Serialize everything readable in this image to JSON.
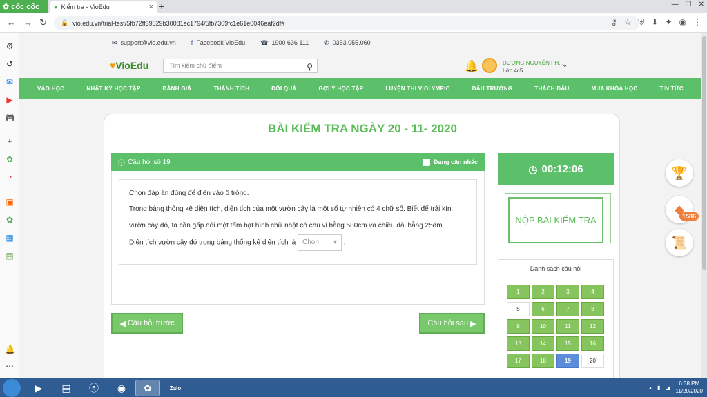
{
  "browser": {
    "brand": "cốc cốc",
    "tab_title": "Kiểm tra - VioEdu",
    "url": "vio.edu.vn/trial-test/5fb72ff39529b30081ec1794/5fb7309fc1e61e0046eaf2df#"
  },
  "header": {
    "email": "support@vio.edu.vn",
    "facebook": "Facebook VioEdu",
    "phone1": "1900 636 111",
    "phone2": "0353.055.060",
    "logo": "VioEdu",
    "search_placeholder": "Tìm kiếm chủ điểm",
    "user_name": "DƯƠNG NGUYỄN PH...",
    "user_class": "Lớp 4c5"
  },
  "menu": [
    "VÀO HỌC",
    "NHẬT KÝ HỌC TẬP",
    "ĐÁNH GIÁ",
    "THÀNH TÍCH",
    "ĐỔI QUÀ",
    "GỢI Ý HỌC TẬP",
    "LUYỆN THI VIOLYMPIC",
    "ĐẤU TRƯỜNG",
    "THÁCH ĐẤU",
    "MUA KHÓA HỌC",
    "TIN TỨC"
  ],
  "test": {
    "title": "BÀI KIỂM TRA NGÀY 20 - 11- 2020",
    "question_label": "Câu hỏi số 19",
    "considering": "Đang cân nhắc",
    "instruction": "Chọn đáp án đúng để điền vào ô trống.",
    "question_text": "Trong bảng thống kê diện tích, diện tích của một vườn cây là một số tự nhiên có 4 chữ số. Biết để trải kín vườn cây đó, ta cần gấp đôi một tấm bạt hình chữ nhật có chu vi bằng 580cm và chiều dài bằng 25dm.",
    "answer_prompt": "Diện tích vườn cây đó trong bảng thống kê diện tích là",
    "select_placeholder": "Chọn",
    "prev_button": "Câu hỏi trước",
    "next_button": "Câu hỏi sau",
    "timer": "00:12:06",
    "submit_button": "NỘP BÀI KIỂM TRA",
    "list_title": "Danh sách câu hỏi",
    "current_question": 19,
    "questions": [
      "1",
      "2",
      "3",
      "4",
      "5",
      "6",
      "7",
      "8",
      "9",
      "10",
      "11",
      "12",
      "13",
      "14",
      "15",
      "16",
      "17",
      "18",
      "19",
      "20"
    ],
    "unanswered": [
      "5",
      "20"
    ]
  },
  "side_widgets": {
    "diamond_count": "1586"
  },
  "taskbar": {
    "time": "6:38 PM",
    "date": "11/20/2020",
    "zalo": "Zalo"
  },
  "colors": {
    "brand_green": "#5cbf6a",
    "current_blue": "#5b8ddb",
    "answered_green": "#86c55d"
  }
}
